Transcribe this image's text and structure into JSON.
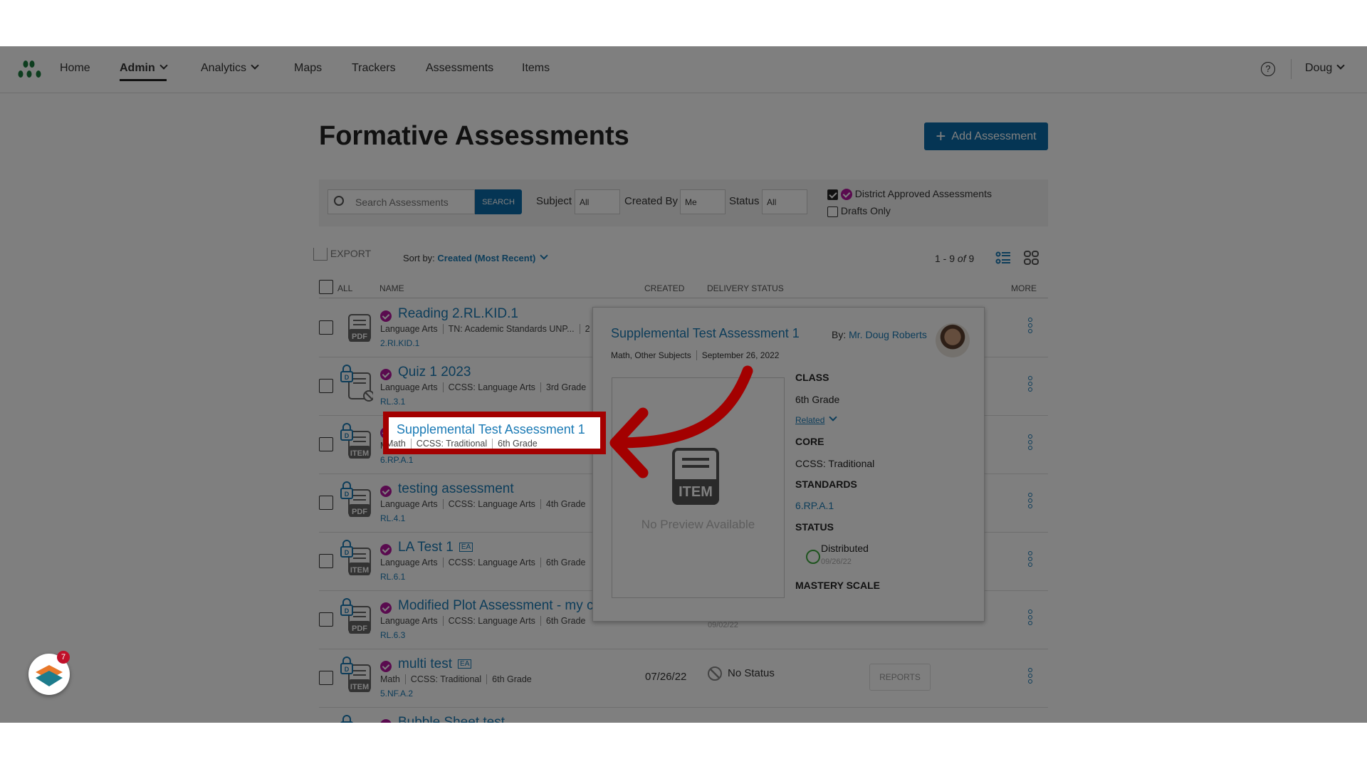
{
  "nav": {
    "items": [
      "Home",
      "Admin",
      "Analytics",
      "Maps",
      "Trackers",
      "Assessments",
      "Items"
    ],
    "active": "Admin",
    "user": "Doug",
    "help_icon": "question-circle-icon",
    "logo_color": "#1a7a3c"
  },
  "page": {
    "title": "Formative Assessments",
    "add_button": "Add Assessment"
  },
  "filters": {
    "search_placeholder": "Search Assessments",
    "search_button": "SEARCH",
    "subject_label": "Subject",
    "subject_value": "All",
    "created_by_label": "Created By",
    "created_by_value": "Me",
    "status_label": "Status",
    "status_value": "All",
    "district_approved_label": "District Approved Assessments",
    "district_approved_checked": true,
    "drafts_only_label": "Drafts Only",
    "drafts_only_checked": false
  },
  "toolbar": {
    "export": "EXPORT",
    "sort_label": "Sort by:",
    "sort_value": "Created (Most Recent)",
    "count": "1 - 9",
    "count_of": "of",
    "count_total": "9"
  },
  "table": {
    "headers": {
      "all": "ALL",
      "name": "NAME",
      "created": "CREATED",
      "delivery": "DELIVERY STATUS",
      "more": "MORE"
    },
    "rows": [
      {
        "name": "Reading 2.RL.KID.1",
        "meta": [
          "Language Arts",
          "TN: Academic Standards UNP...",
          "2"
        ],
        "standard": "2.RI.KID.1",
        "type": "PDF",
        "locked": false
      },
      {
        "name": "Quiz 1 2023",
        "meta": [
          "Language Arts",
          "CCSS: Language Arts",
          "3rd Grade"
        ],
        "standard": "RL.3.1",
        "type": "blocked",
        "locked": true
      },
      {
        "name": "Supplemental Test Assessment 1",
        "meta": [
          "Math",
          "CCSS: Traditional",
          "6th Grade"
        ],
        "standard": "6.RP.A.1",
        "type": "ITEM",
        "locked": true
      },
      {
        "name": "testing assessment",
        "meta": [
          "Language Arts",
          "CCSS: Language Arts",
          "4th Grade"
        ],
        "standard": "RL.4.1",
        "type": "PDF",
        "locked": true
      },
      {
        "name": "LA Test 1",
        "ea": "EA",
        "meta": [
          "Language Arts",
          "CCSS: Language Arts",
          "6th Grade"
        ],
        "standard": "RL.6.1",
        "type": "ITEM",
        "locked": true
      },
      {
        "name": "Modified Plot Assessment - my co",
        "meta": [
          "Language Arts",
          "CCSS: Language Arts",
          "6th Grade"
        ],
        "standard": "RL.6.3",
        "type": "PDF",
        "locked": true,
        "status_date": "09/02/22"
      },
      {
        "name": "multi test",
        "ea": "EA",
        "meta": [
          "Math",
          "CCSS: Traditional",
          "6th Grade"
        ],
        "standard": "5.NF.A.2",
        "type": "ITEM",
        "locked": true,
        "created": "07/26/22",
        "status": "No Status",
        "reports": "REPORTS"
      },
      {
        "name": "Bubble Sheet test",
        "meta": [],
        "standard": "",
        "type": "ITEM",
        "locked": true
      }
    ]
  },
  "popup": {
    "title": "Supplemental Test Assessment 1",
    "by_label": "By:",
    "author": "Mr. Doug Roberts",
    "subjects": "Math, Other Subjects",
    "date": "September 26, 2022",
    "preview_type": "ITEM",
    "no_preview": "No Preview Available",
    "class_label": "CLASS",
    "class_value": "6th Grade",
    "related": "Related",
    "core_label": "CORE",
    "core_value": "CCSS: Traditional",
    "standards_label": "STANDARDS",
    "standards_value": "6.RP.A.1",
    "status_label": "STATUS",
    "status_value": "Distributed",
    "status_date": "09/26/22",
    "mastery_label": "MASTERY SCALE"
  },
  "widget": {
    "notification_count": "7"
  },
  "colors": {
    "accent": "#1a7ab5",
    "primary_button": "#0a6aa8",
    "badge": "#b5179e",
    "highlight": "#a30000"
  }
}
